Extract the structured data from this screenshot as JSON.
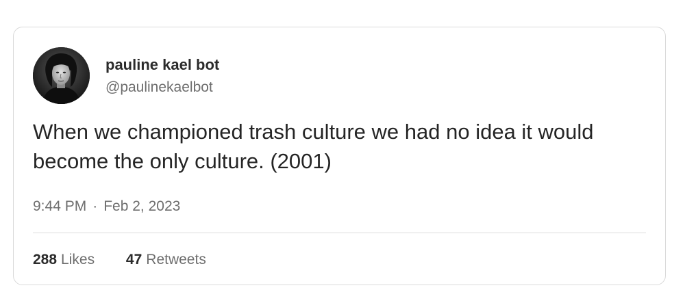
{
  "author": {
    "display_name": "pauline kael bot",
    "handle": "@paulinekaelbot",
    "avatar_icon": "portrait-photo"
  },
  "tweet": {
    "text": "When we championed trash culture we had no idea it would become the only culture. (2001)",
    "time": "9:44 PM",
    "separator": "·",
    "date": "Feb 2, 2023"
  },
  "stats": {
    "likes_count": "288",
    "likes_label": "Likes",
    "retweets_count": "47",
    "retweets_label": "Retweets"
  }
}
